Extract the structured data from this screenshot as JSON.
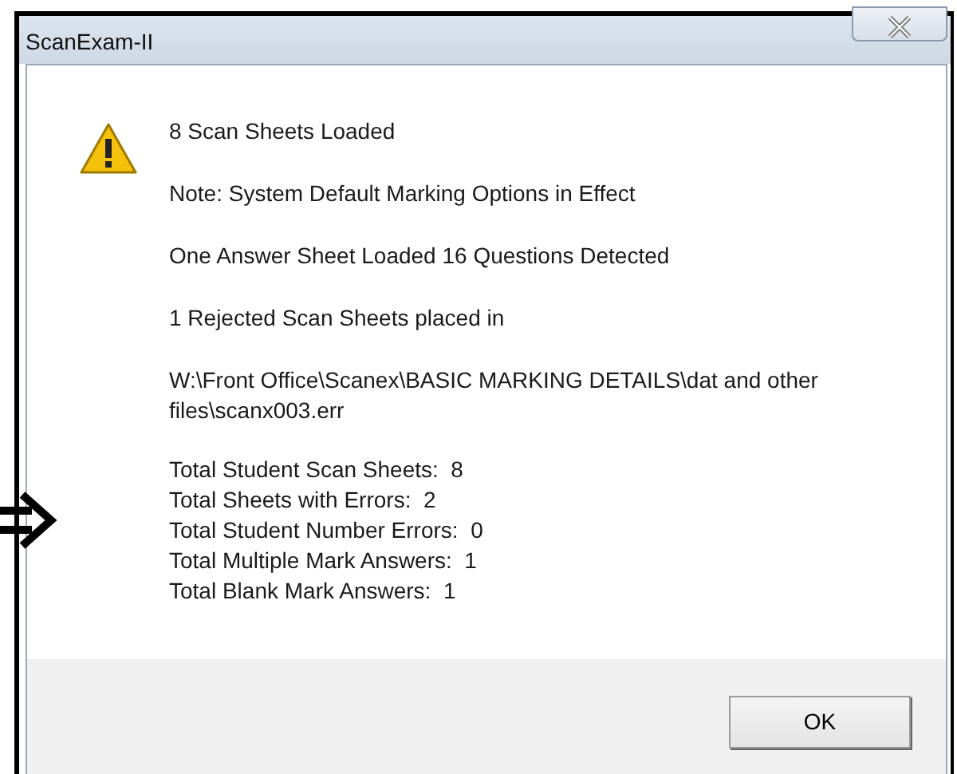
{
  "window": {
    "title": "ScanExam-II"
  },
  "messages": [
    "8 Scan Sheets Loaded",
    "Note: System Default Marking Options in Effect",
    "One Answer Sheet Loaded 16 Questions Detected",
    "1 Rejected Scan Sheets placed in",
    "W:\\Front Office\\Scanex\\BASIC MARKING DETAILS\\dat and other files\\scanx003.err"
  ],
  "totals": [
    "Total Student Scan Sheets:  8",
    "Total Sheets with Errors:  2",
    "Total Student Number Errors:  0",
    "Total Multiple Mark Answers:  1",
    "Total Blank Mark Answers:  1"
  ],
  "buttons": [
    "OK"
  ]
}
